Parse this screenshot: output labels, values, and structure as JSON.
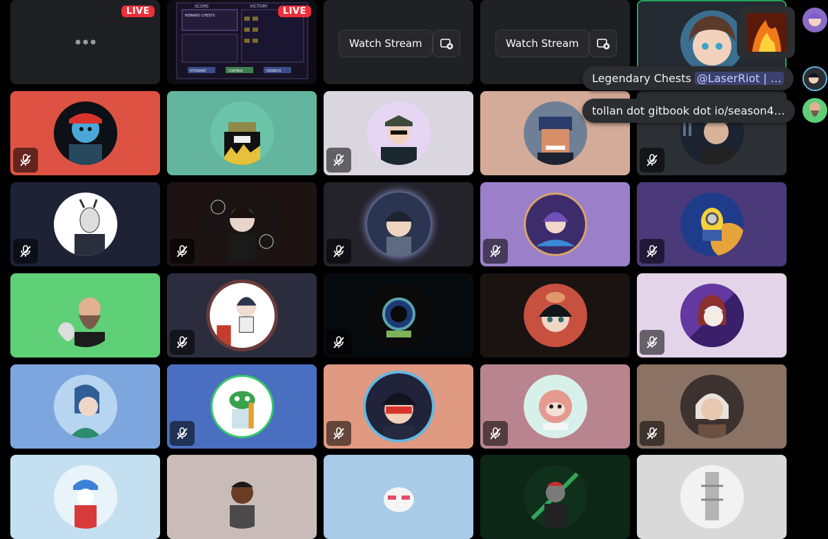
{
  "live_badge": "LIVE",
  "watch_stream_label": "Watch Stream",
  "chat": {
    "msg1_text": "Legendary Chests",
    "msg1_mention": "@LaserRiot | …",
    "msg2_text": "tollan dot gitbook dot io/season4…"
  },
  "game_screenshot": {
    "score_label": "SCORE",
    "victory_label": "VICTORY",
    "rewards_label": "REWARD CHESTS",
    "buttons": [
      "ATTENDANT",
      "CONTINUE",
      "FEEDBACK"
    ]
  },
  "colors": {
    "speaking_border": "#23a559",
    "live_red": "#ec2f3b",
    "mention_bg": "#3c4270"
  },
  "icons": {
    "mute": "microphone-slash-icon",
    "add_stream": "add-stream-icon",
    "more": "more-dots-icon"
  }
}
